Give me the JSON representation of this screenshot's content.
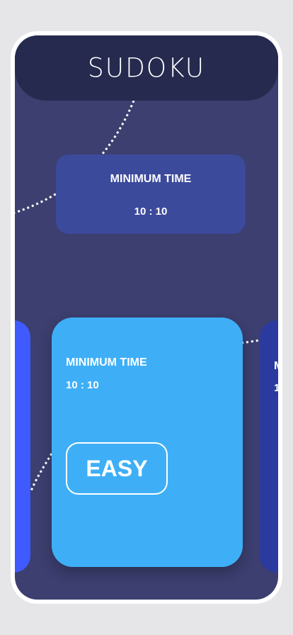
{
  "app": {
    "title": "SUDOKU"
  },
  "cards": {
    "top": {
      "label": "MINIMUM TIME",
      "time": "10 : 10"
    },
    "main": {
      "label": "MINIMUM TIME",
      "time": "10 : 10",
      "difficulty_button": "EASY"
    },
    "right_partial": {
      "label": "M",
      "time": "1"
    }
  },
  "colors": {
    "background": "#3c3f6f",
    "header": "#262a4f",
    "top_card": "#3c4a9c",
    "main_card": "#3eaff7",
    "left_card": "#3f5bff",
    "right_card": "#2b3a9e"
  }
}
